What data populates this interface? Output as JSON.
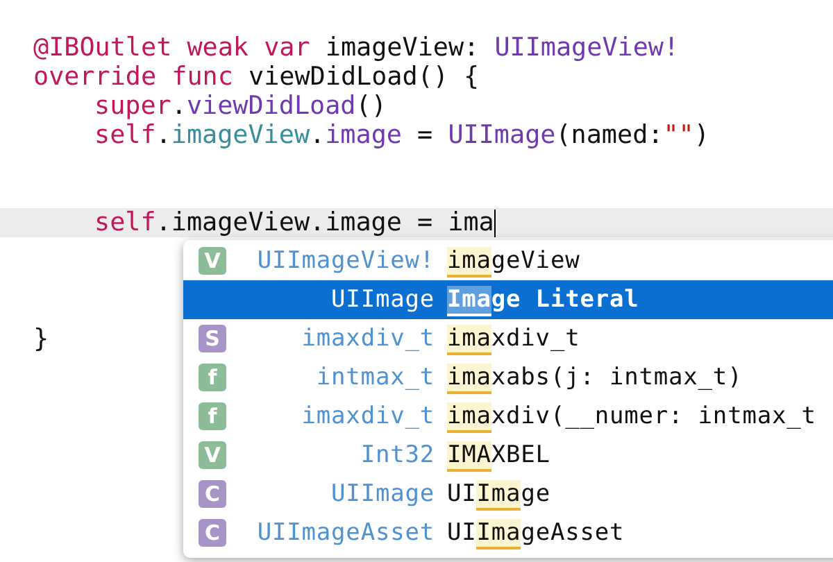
{
  "code_lines": [
    {
      "kind": "code",
      "indented": false,
      "current": false,
      "tokens": [
        {
          "kind": "keyword",
          "text": "@IBOutlet weak var"
        },
        {
          "kind": "plain",
          "text": " imageView: "
        },
        {
          "kind": "type",
          "text": "UIImageView!"
        }
      ]
    },
    {
      "kind": "code",
      "indented": false,
      "current": false,
      "tokens": [
        {
          "kind": "keyword",
          "text": "override func"
        },
        {
          "kind": "plain",
          "text": " viewDidLoad() {"
        }
      ]
    },
    {
      "kind": "code",
      "indented": true,
      "current": false,
      "tokens": [
        {
          "kind": "keyword",
          "text": "super"
        },
        {
          "kind": "plain",
          "text": "."
        },
        {
          "kind": "type",
          "text": "viewDidLoad"
        },
        {
          "kind": "plain",
          "text": "()"
        }
      ]
    },
    {
      "kind": "code",
      "indented": true,
      "current": false,
      "tokens": [
        {
          "kind": "keyword",
          "text": "self"
        },
        {
          "kind": "plain",
          "text": "."
        },
        {
          "kind": "property",
          "text": "imageView"
        },
        {
          "kind": "plain",
          "text": "."
        },
        {
          "kind": "type",
          "text": "image"
        },
        {
          "kind": "plain",
          "text": " = "
        },
        {
          "kind": "type",
          "text": "UIImage"
        },
        {
          "kind": "plain",
          "text": "(named:"
        },
        {
          "kind": "string",
          "text": "\"\""
        },
        {
          "kind": "plain",
          "text": ")"
        }
      ]
    },
    {
      "kind": "blank"
    },
    {
      "kind": "blank"
    },
    {
      "kind": "code",
      "indented": true,
      "current": true,
      "tokens": [
        {
          "kind": "keyword",
          "text": "self"
        },
        {
          "kind": "plain",
          "text": ".imageView.image = ima"
        }
      ]
    },
    {
      "kind": "blank"
    },
    {
      "kind": "blank"
    },
    {
      "kind": "blank"
    },
    {
      "kind": "code",
      "indented": false,
      "current": false,
      "tokens": [
        {
          "kind": "plain",
          "text": "}"
        }
      ]
    }
  ],
  "completions": [
    {
      "selected": false,
      "badge": {
        "letter": "V",
        "color": "#8dbc98"
      },
      "type": "UIImageView!",
      "name": [
        {
          "text": "ima",
          "match": true
        },
        {
          "text": "geView",
          "match": false
        }
      ]
    },
    {
      "selected": true,
      "type": "UIImage",
      "name": [
        {
          "text": "Ima",
          "match": true
        },
        {
          "text": "ge Literal",
          "match": false
        }
      ]
    },
    {
      "selected": false,
      "badge": {
        "letter": "S",
        "color": "#a795c8"
      },
      "type": "imaxdiv_t",
      "name": [
        {
          "text": "ima",
          "match": true
        },
        {
          "text": "xdiv_t",
          "match": false
        }
      ]
    },
    {
      "selected": false,
      "badge": {
        "letter": "f",
        "color": "#8dbc98"
      },
      "type": "intmax_t",
      "name": [
        {
          "text": "ima",
          "match": true
        },
        {
          "text": "xabs(j: intmax_t)",
          "match": false
        }
      ]
    },
    {
      "selected": false,
      "badge": {
        "letter": "f",
        "color": "#8dbc98"
      },
      "type": "imaxdiv_t",
      "name": [
        {
          "text": "ima",
          "match": true
        },
        {
          "text": "xdiv(__numer: intmax_t",
          "match": false
        }
      ]
    },
    {
      "selected": false,
      "badge": {
        "letter": "V",
        "color": "#8dbc98"
      },
      "type": "Int32",
      "name": [
        {
          "text": "IMA",
          "match": true
        },
        {
          "text": "XBEL",
          "match": false
        }
      ]
    },
    {
      "selected": false,
      "badge": {
        "letter": "C",
        "color": "#a795c8"
      },
      "type": "UIImage",
      "name": [
        {
          "text": "UI",
          "match": false
        },
        {
          "text": "Ima",
          "match": true
        },
        {
          "text": "ge",
          "match": false
        }
      ]
    },
    {
      "selected": false,
      "badge": {
        "letter": "C",
        "color": "#a795c8"
      },
      "type": "UIImageAsset",
      "name": [
        {
          "text": "UI",
          "match": false
        },
        {
          "text": "Ima",
          "match": true
        },
        {
          "text": "geAsset",
          "match": false
        }
      ]
    }
  ]
}
